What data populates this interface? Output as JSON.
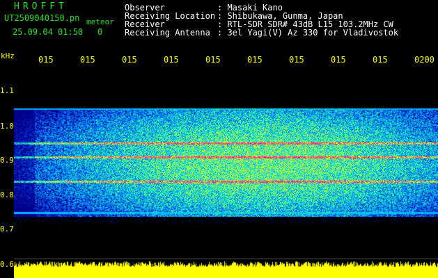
{
  "header": {
    "logo": "HROFFT",
    "filename": "UT2509040150.pn",
    "tag": "meteor",
    "datetime": "25.09.04 01:50",
    "count": "0"
  },
  "info": [
    {
      "label": "Observer",
      "value": ": Masaki Kano"
    },
    {
      "label": "Receiving Location",
      "value": ": Shibukawa, Gunma, Japan"
    },
    {
      "label": "Receiver",
      "value": ": RTL-SDR SDR# 43dB L15 103.2MHz CW"
    },
    {
      "label": "Receiving Antenna",
      "value": ": 3el Yagi(V) Az 330 for Vladivostok"
    }
  ],
  "time_ticks": [
    "015",
    "015",
    "015",
    "015",
    "015",
    "015",
    "015",
    "015",
    "015",
    "0200"
  ],
  "y_axis": {
    "unit": "kHz",
    "labels": [
      "1.1",
      "1.0",
      "0.9",
      "0.8",
      "0.7",
      "0.6"
    ]
  },
  "chart_data": {
    "type": "heatmap",
    "title": "",
    "xlabel": "",
    "ylabel": "kHz",
    "x_ticks": [
      "015",
      "015",
      "015",
      "015",
      "015",
      "015",
      "015",
      "015",
      "015",
      "0200"
    ],
    "y_ticks": [
      1.1,
      1.0,
      0.9,
      0.8,
      0.7,
      0.6
    ],
    "ylim": [
      0.6,
      1.15
    ],
    "signal_band_khz": [
      0.74,
      1.05
    ],
    "strong_lines_khz": [
      0.95,
      0.84,
      0.91
    ],
    "edge_lines_khz": [
      1.05,
      0.75
    ],
    "colormap": [
      "#00008b",
      "#0050ff",
      "#00d0ff",
      "#40ff80",
      "#ffff00",
      "#ff2090"
    ],
    "amplitude_trace_color": "#ffff00"
  }
}
